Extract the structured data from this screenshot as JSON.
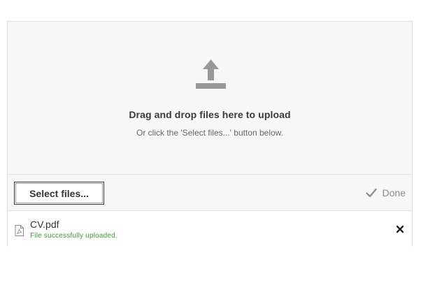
{
  "dropzone": {
    "icon": "upload-icon",
    "title": "Drag and drop files here to upload",
    "hint": "Or click the 'Select files...' button below."
  },
  "toolbar": {
    "select_label": "Select files...",
    "done_label": "Done",
    "done_icon": "check-icon"
  },
  "files": [
    {
      "icon": "pdf-file-icon",
      "name": "CV.pdf",
      "status": "File successfully uploaded.",
      "status_color": "#3c9a34",
      "remove_icon": "close-icon"
    }
  ]
}
